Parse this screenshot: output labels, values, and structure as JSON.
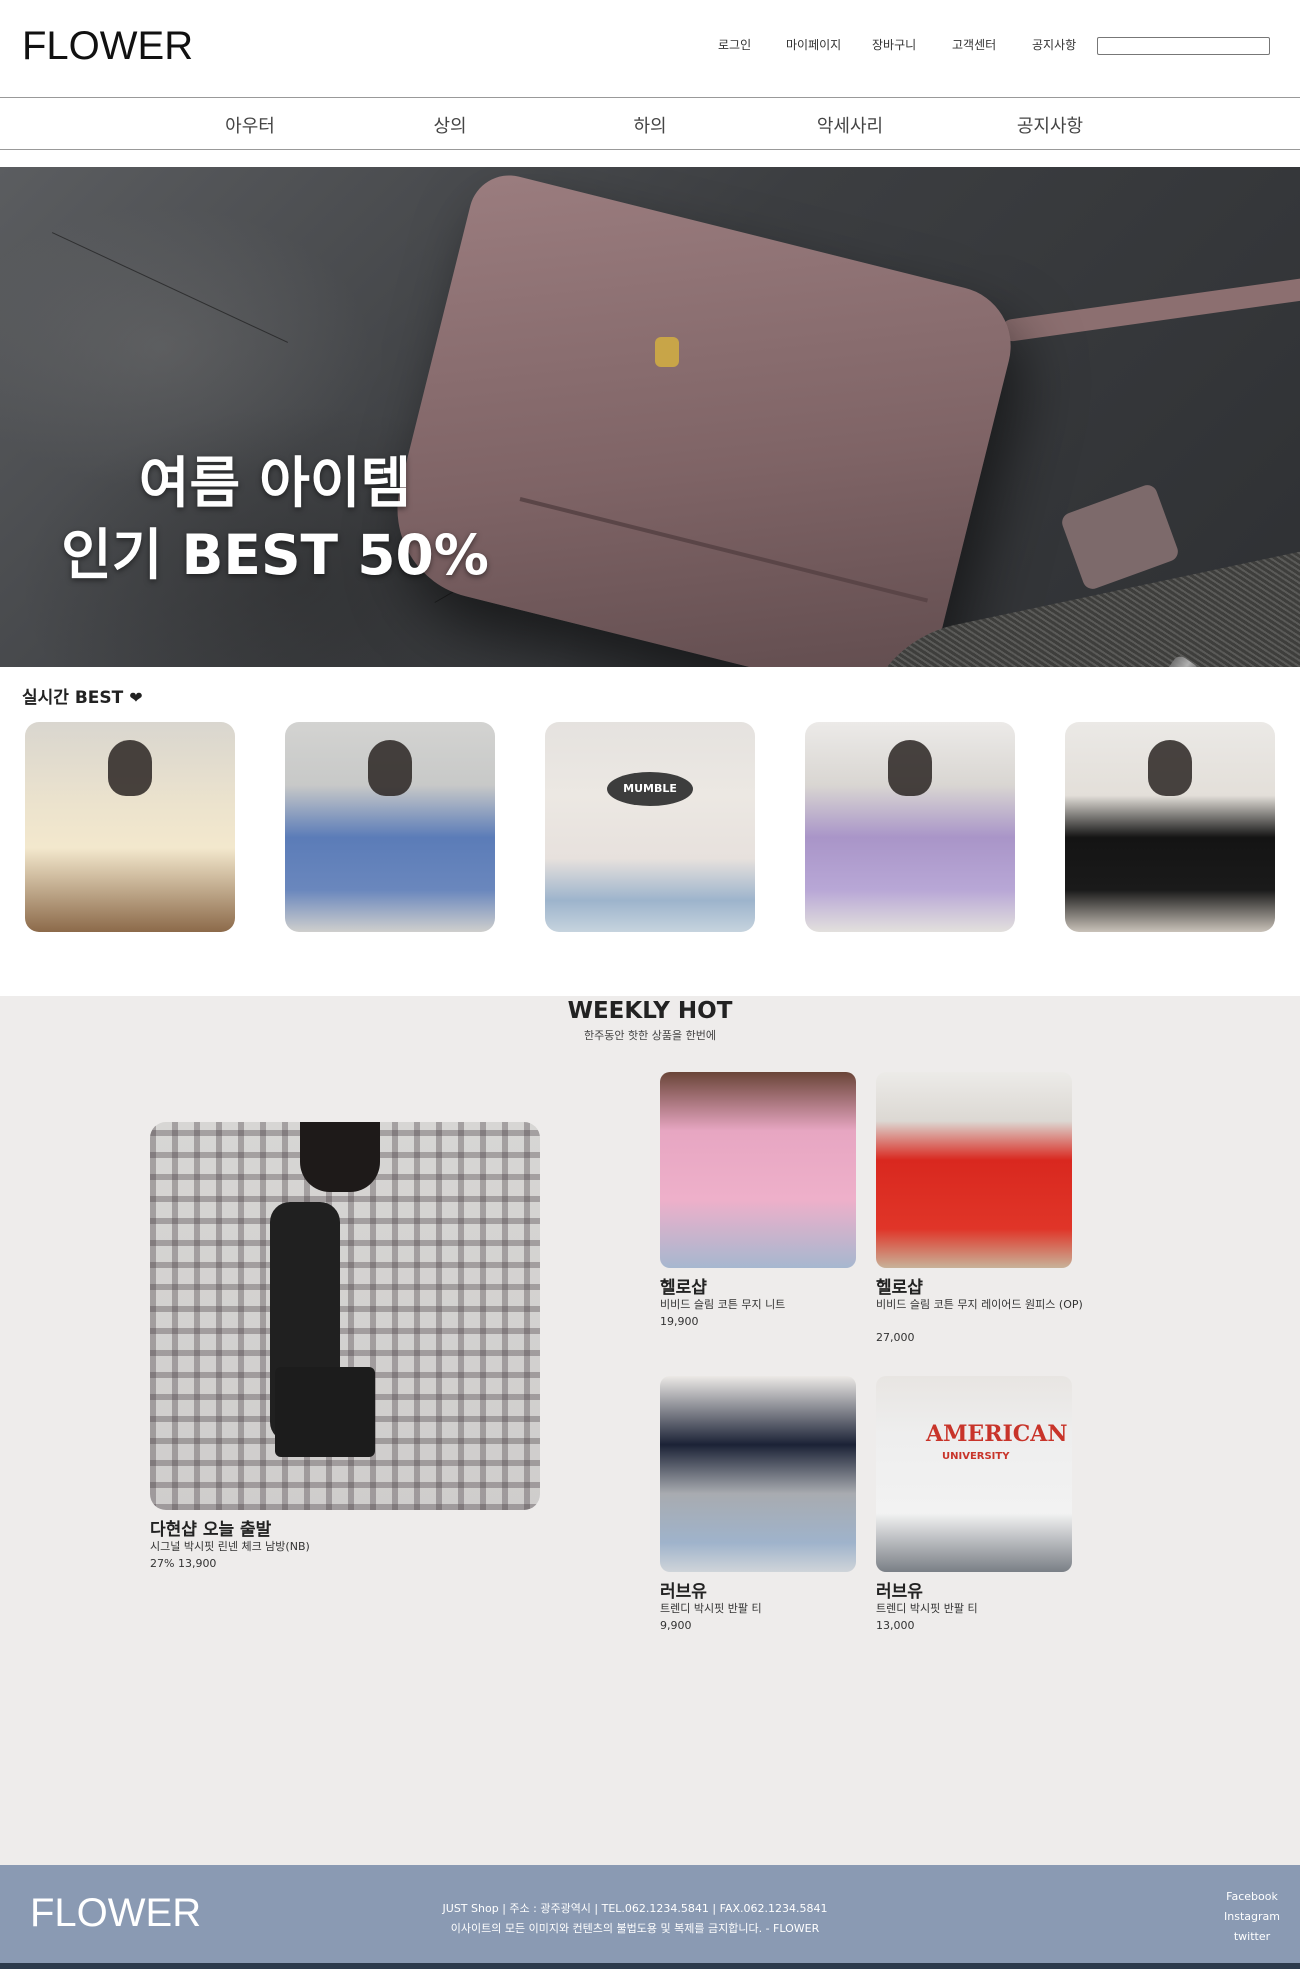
{
  "header": {
    "logo": "FLOWER",
    "top_links": [
      "로그인",
      "마이페이지",
      "장바구니",
      "고객센터",
      "공지사항"
    ],
    "search": {
      "value": "",
      "placeholder": ""
    }
  },
  "nav": {
    "categories": [
      "아우터",
      "상의",
      "하의",
      "악세사리",
      "공지사항"
    ]
  },
  "hero": {
    "line1": "여름 아이템",
    "line2": "인기 BEST 50%"
  },
  "best": {
    "title": "실시간 BEST",
    "icon": "heart-icon",
    "shirt_print": "MUMBLE"
  },
  "weekly": {
    "title": "WEEKLY HOT",
    "subtitle": "한주동안 핫한 상품을 한번에",
    "featured": {
      "shop": "다현샵 오늘 출발",
      "desc": "시그널 박시핏 린넨 체크 남방(NB)",
      "price": "27% 13,900"
    },
    "items": [
      {
        "shop": "헬로샵",
        "desc": "비비드 슬림 코튼 무지 니트",
        "price": "19,900"
      },
      {
        "shop": "헬로샵",
        "desc": "비비드 슬림 코튼 무지 레이어드 원피스 (OP)",
        "price": "27,000"
      },
      {
        "shop": "러브유",
        "desc": "트렌디 박시핏 반팔 티",
        "price": "9,900"
      },
      {
        "shop": "러브유",
        "desc": "트렌디 박시핏 반팔 티",
        "price": "13,000",
        "print": "AMERICAN",
        "print_sub": "UNIVERSITY"
      }
    ]
  },
  "footer": {
    "logo": "FLOWER",
    "info_line1": "JUST Shop | 주소 : 광주광역시 | TEL.062.1234.5841 | FAX.062.1234.5841",
    "info_line2": "이사이트의 모든 이미지와 컨텐츠의 불법도용 및 복제를 금지합니다. - FLOWER",
    "social": [
      "Facebook",
      "Instagram",
      "twitter"
    ]
  },
  "colors": {
    "footer_bg": "#8a9ab3",
    "weekly_bg": "#eeeceb"
  }
}
